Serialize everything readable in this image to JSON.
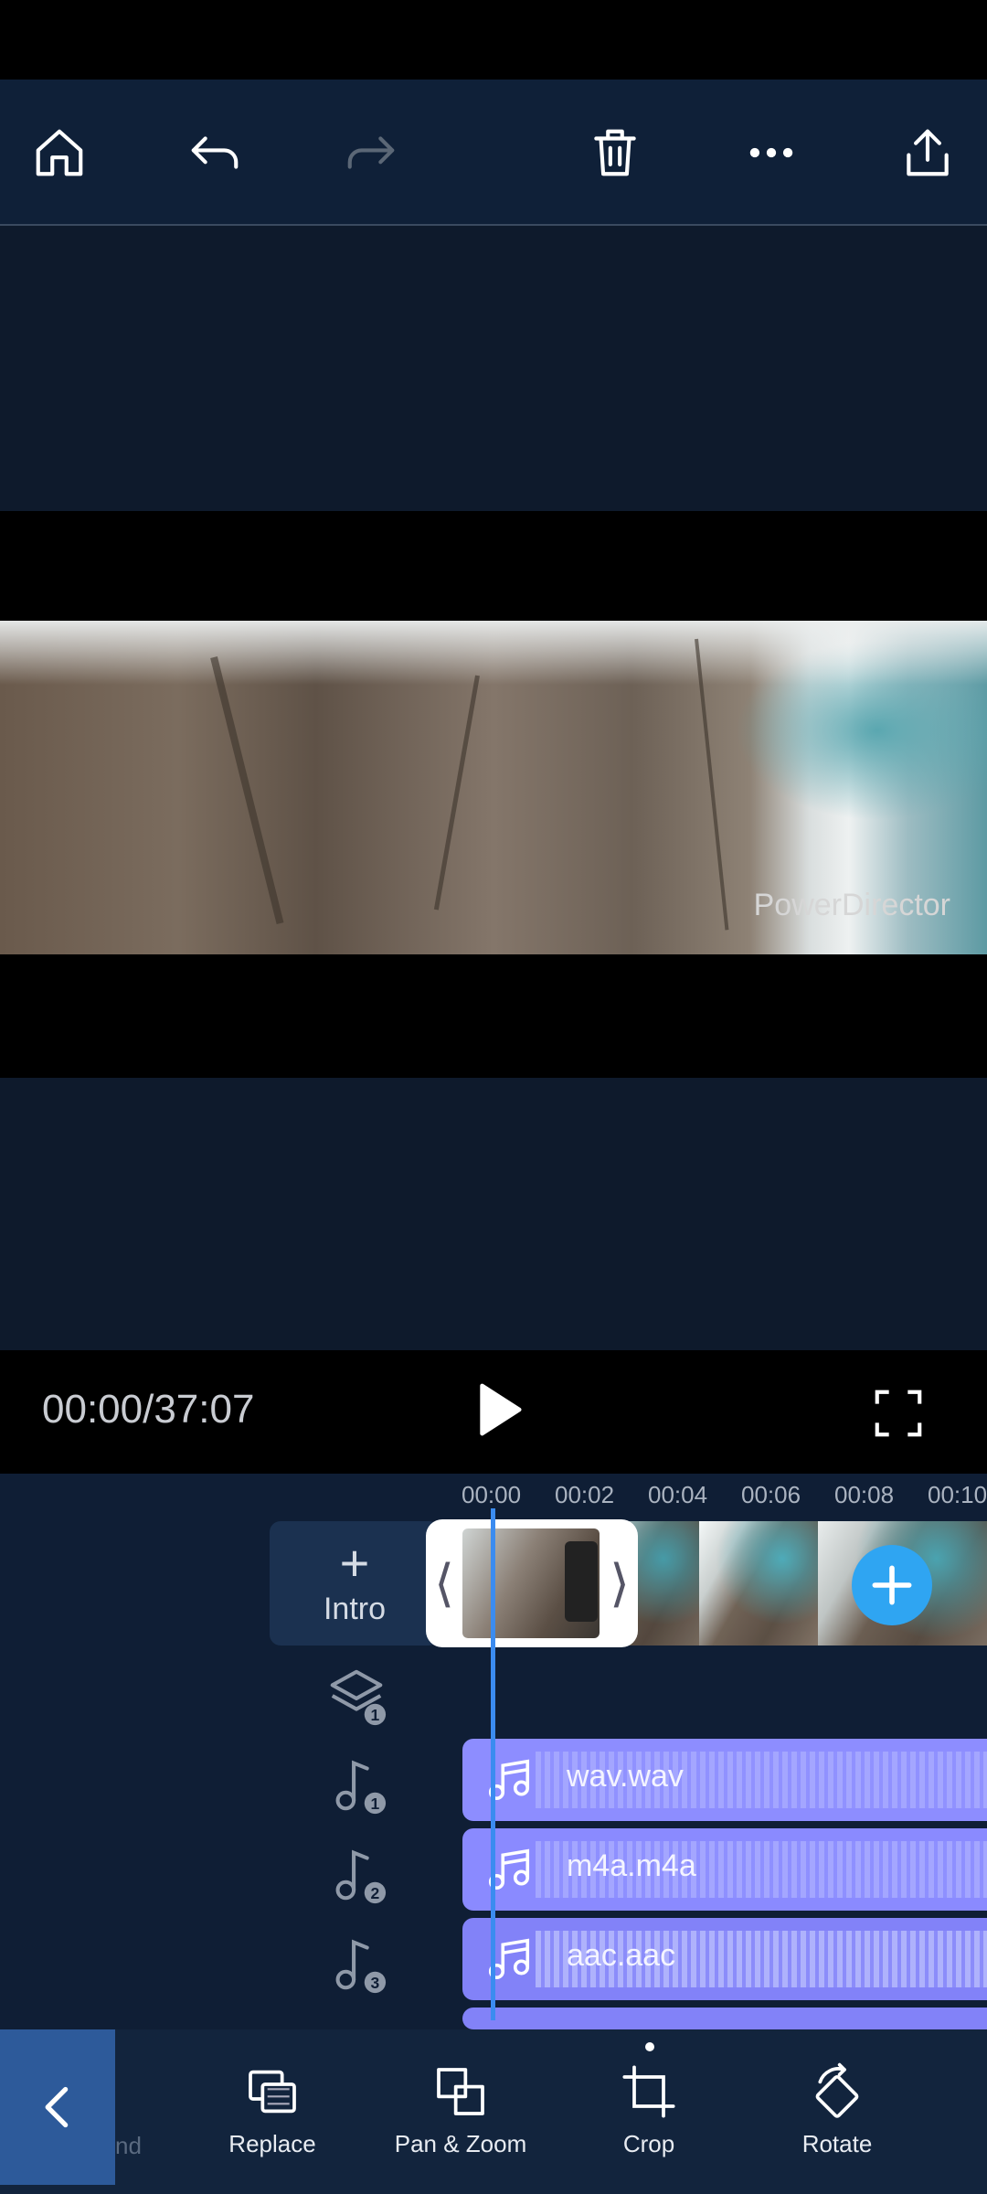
{
  "toolbar": {
    "home_icon": "home-icon",
    "undo_icon": "undo-icon",
    "redo_icon": "redo-icon",
    "delete_icon": "trash-icon",
    "more_icon": "more-horizontal-icon",
    "export_icon": "share-upload-icon"
  },
  "preview": {
    "watermark": "PowerDirector"
  },
  "player": {
    "timecode": "00:00/37:07"
  },
  "timeline": {
    "ruler": [
      "00:00",
      "00:02",
      "00:04",
      "00:06",
      "00:08",
      "00:10"
    ],
    "intro_label": "Intro",
    "intro_plus": "+",
    "audio_tracks": [
      {
        "index": "1",
        "name": "wav.wav"
      },
      {
        "index": "2",
        "name": "m4a.m4a"
      },
      {
        "index": "3",
        "name": "aac.aac"
      }
    ],
    "overlay_layer_index": "1"
  },
  "bottom_tools": {
    "faded_label": "nd",
    "replace": "Replace",
    "pan_zoom": "Pan & Zoom",
    "crop": "Crop",
    "rotate": "Rotate"
  },
  "colors": {
    "toolbar_bg": "#0f2038",
    "timeline_bg": "#0f1e35",
    "audio_clip": "#8888ff",
    "playhead": "#3b8cf0",
    "add_button": "#2fa5f2",
    "back_button": "#2d5a9a"
  }
}
